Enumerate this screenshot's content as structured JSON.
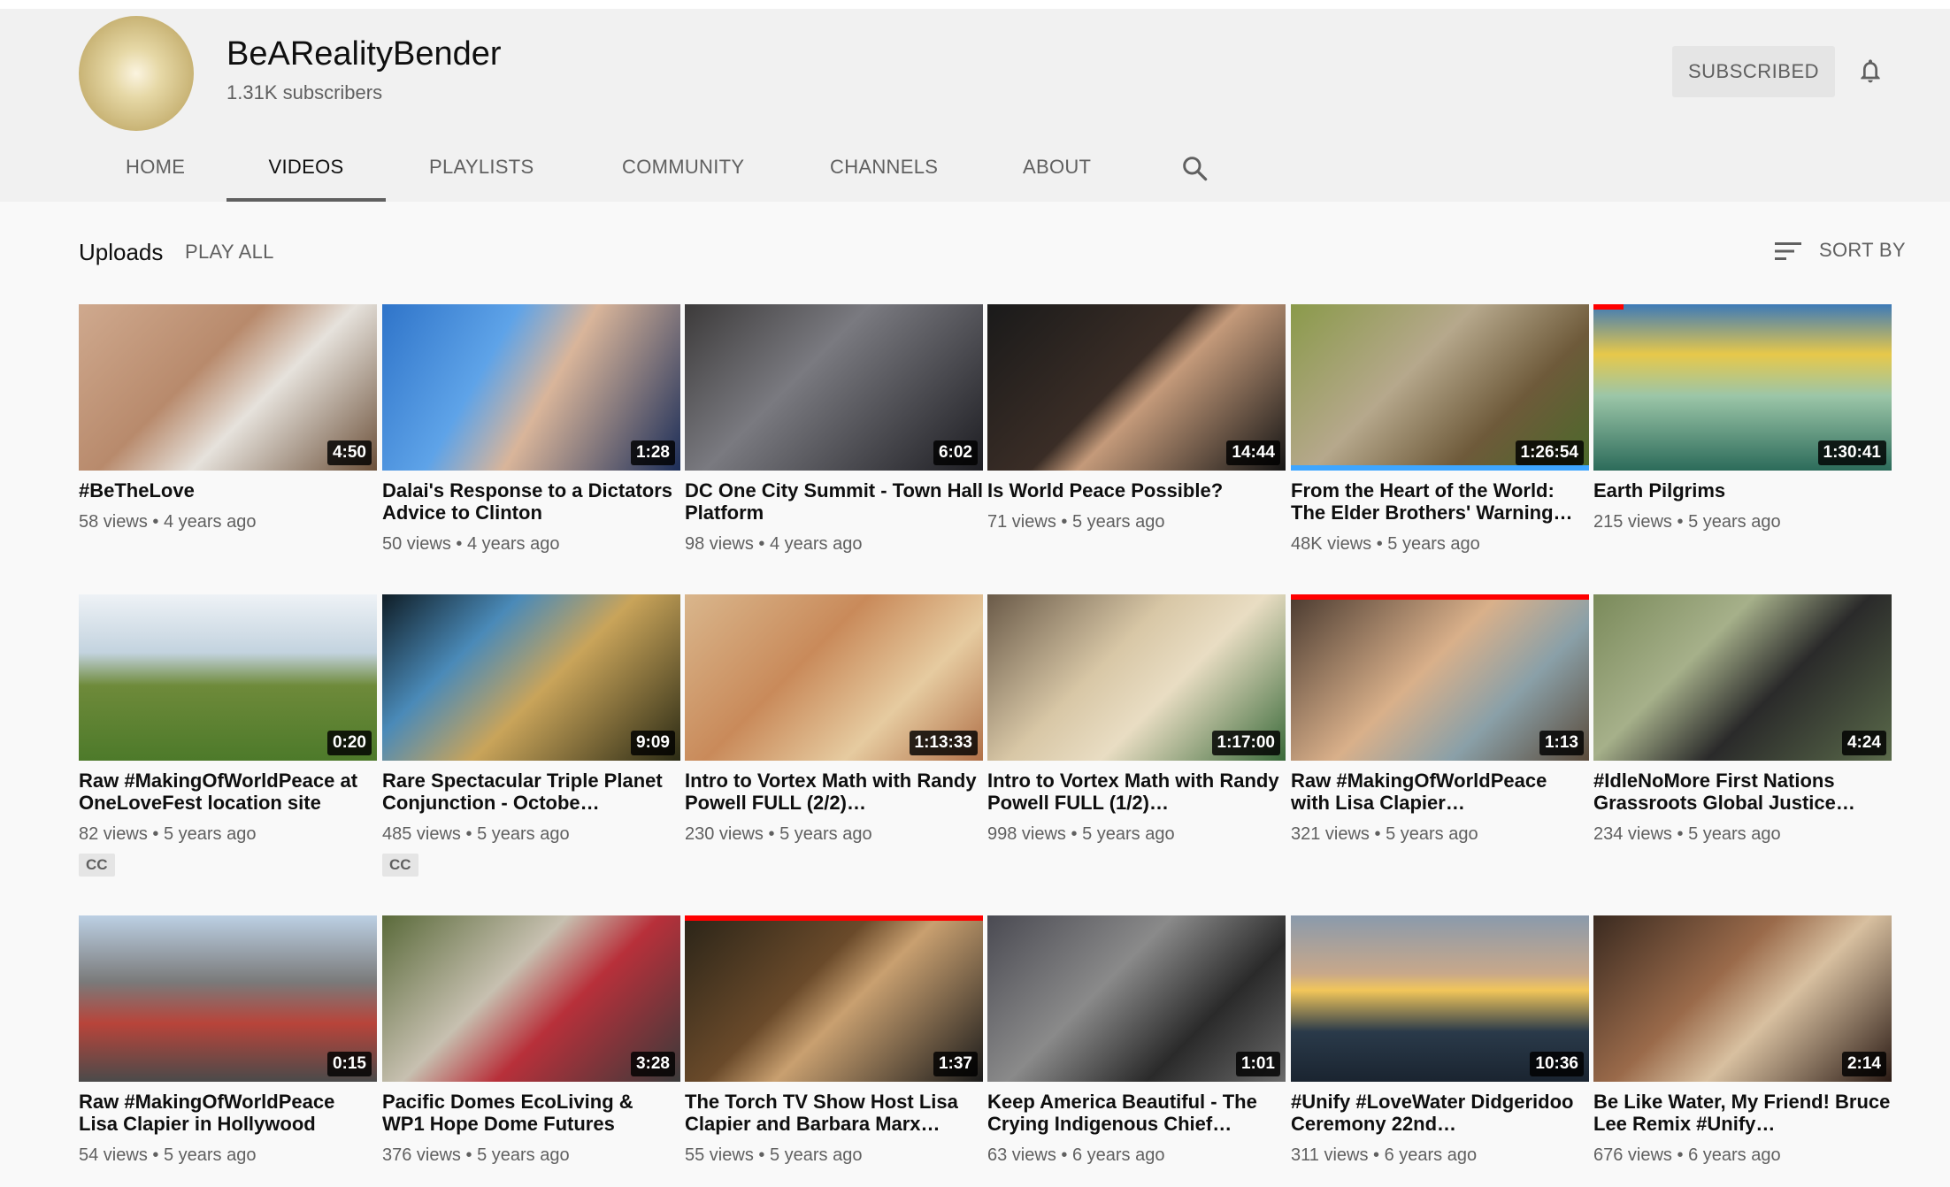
{
  "channel": {
    "name": "BeARealityBender",
    "subscribers": "1.31K subscribers",
    "subscribe_label": "SUBSCRIBED",
    "bell_icon": "bell-icon"
  },
  "tabs": [
    {
      "label": "HOME"
    },
    {
      "label": "VIDEOS",
      "active": true
    },
    {
      "label": "PLAYLISTS"
    },
    {
      "label": "COMMUNITY"
    },
    {
      "label": "CHANNELS"
    },
    {
      "label": "ABOUT"
    }
  ],
  "section": {
    "title": "Uploads",
    "play_all": "PLAY ALL",
    "sort_label": "SORT BY"
  },
  "colors": {
    "progress_red": "#ff0000",
    "progress_blue": "#3ea6ff",
    "header_bg": "#f1f1f1",
    "page_bg": "#f9f9f9"
  },
  "videos": [
    {
      "title": "#BeTheLove",
      "duration": "4:50",
      "views": "58 views",
      "age": "4 years ago"
    },
    {
      "title": "Dalai's Response to a Dictators Advice to Clinton",
      "duration": "1:28",
      "views": "50 views",
      "age": "4 years ago"
    },
    {
      "title": "DC One City Summit - Town Hall Platform",
      "duration": "6:02",
      "views": "98 views",
      "age": "4 years ago"
    },
    {
      "title": "Is World Peace Possible?",
      "duration": "14:44",
      "views": "71 views",
      "age": "5 years ago"
    },
    {
      "title": "From the Heart of the World: The Elder Brothers' Warning…",
      "duration": "1:26:54",
      "views": "48K views",
      "age": "5 years ago",
      "watched_fraction": 1.0
    },
    {
      "title": "Earth Pilgrims",
      "duration": "1:30:41",
      "views": "215 views",
      "age": "5 years ago",
      "watched_fraction": 0.1
    },
    {
      "title": "Raw #MakingOfWorldPeace at OneLoveFest location site",
      "duration": "0:20",
      "views": "82 views",
      "age": "5 years ago",
      "badge": "CC"
    },
    {
      "title": "Rare Spectacular Triple Planet Conjunction - Octobe…",
      "duration": "9:09",
      "views": "485 views",
      "age": "5 years ago",
      "badge": "CC"
    },
    {
      "title": "Intro to Vortex Math with Randy Powell FULL (2/2)…",
      "duration": "1:13:33",
      "views": "230 views",
      "age": "5 years ago"
    },
    {
      "title": "Intro to Vortex Math with Randy Powell FULL (1/2)…",
      "duration": "1:17:00",
      "views": "998 views",
      "age": "5 years ago"
    },
    {
      "title": "Raw #MakingOfWorldPeace with Lisa Clapier…",
      "duration": "1:13",
      "views": "321 views",
      "age": "5 years ago",
      "watched_fraction": 1.0
    },
    {
      "title": "#IdleNoMore First Nations Grassroots Global Justice…",
      "duration": "4:24",
      "views": "234 views",
      "age": "5 years ago"
    },
    {
      "title": "Raw #MakingOfWorldPeace Lisa Clapier in Hollywood",
      "duration": "0:15",
      "views": "54 views",
      "age": "5 years ago"
    },
    {
      "title": "Pacific Domes EcoLiving & WP1 Hope Dome Futures",
      "duration": "3:28",
      "views": "376 views",
      "age": "5 years ago"
    },
    {
      "title": "The Torch TV Show Host Lisa Clapier and Barbara Marx…",
      "duration": "1:37",
      "views": "55 views",
      "age": "5 years ago",
      "watched_fraction": 1.0
    },
    {
      "title": "Keep America Beautiful - The Crying Indigenous Chief…",
      "duration": "1:01",
      "views": "63 views",
      "age": "6 years ago"
    },
    {
      "title": "#Unify #LoveWater Didgeridoo Ceremony 22nd…",
      "duration": "10:36",
      "views": "311 views",
      "age": "6 years ago"
    },
    {
      "title": "Be Like Water, My Friend! Bruce Lee Remix #Unify…",
      "duration": "2:14",
      "views": "676 views",
      "age": "6 years ago"
    }
  ]
}
